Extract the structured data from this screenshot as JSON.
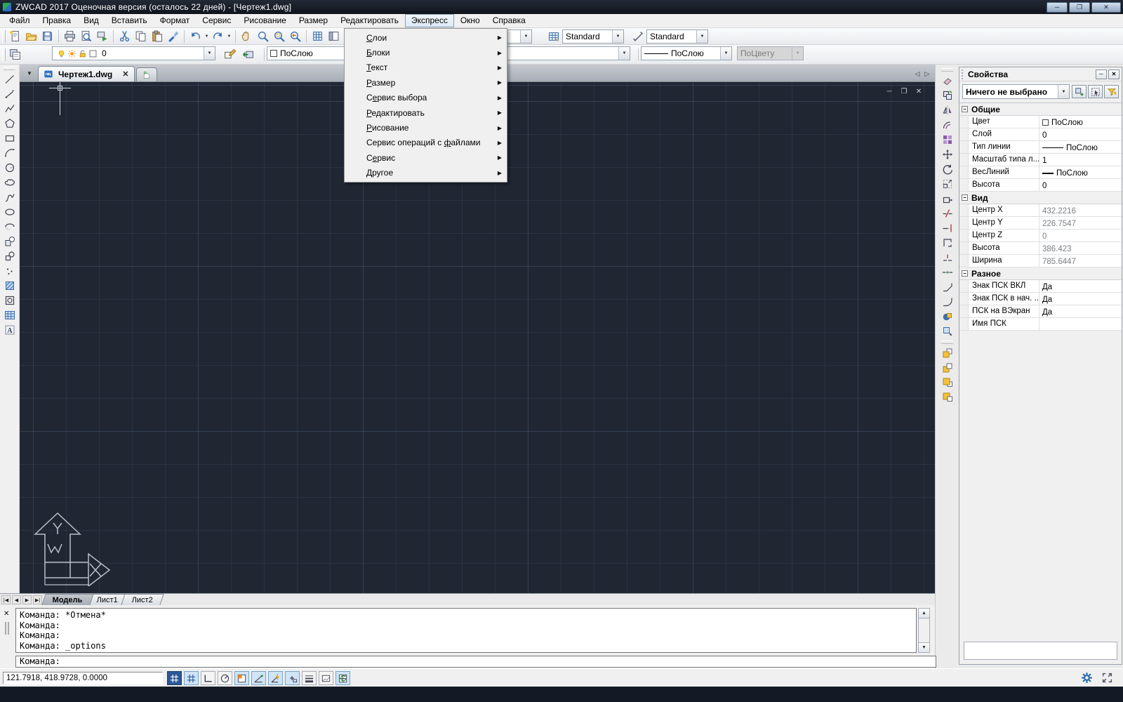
{
  "window": {
    "title": "ZWCAD 2017 Оценочная версия (осталось 22 дней) - [Чертеж1.dwg]",
    "buttons": [
      {
        "name": "minimize",
        "glyph": "─"
      },
      {
        "name": "maximize",
        "glyph": "❐"
      },
      {
        "name": "close",
        "glyph": "✕"
      }
    ]
  },
  "menu_bar": {
    "items": [
      "Файл",
      "Правка",
      "Вид",
      "Вставить",
      "Формат",
      "Сервис",
      "Рисование",
      "Размер",
      "Редактировать",
      "Экспресс",
      "Окно",
      "Справка"
    ],
    "active": "Экспресс"
  },
  "express_menu": {
    "items": [
      {
        "label": "Слои",
        "u": 0
      },
      {
        "label": "Блоки",
        "u": 0
      },
      {
        "label": "Текст",
        "u": 0
      },
      {
        "label": "Размер",
        "u": 0
      },
      {
        "label": "Сервис выбора",
        "u": 1
      },
      {
        "label": "Редактировать",
        "u": 0
      },
      {
        "label": "Рисование",
        "u": 0
      },
      {
        "label": "Сервис операций с файлами",
        "u": 18
      },
      {
        "label": "Сервис",
        "u": 1
      },
      {
        "label": "Другое",
        "u": 0
      }
    ]
  },
  "standard_toolbar": {
    "groups": [
      [
        "new",
        "open",
        "save"
      ],
      [
        "print",
        "print-preview",
        "publish"
      ],
      [
        "cut",
        "copy",
        "paste",
        "match-properties"
      ],
      [
        "undo",
        "redo"
      ],
      [
        "pan",
        "zoom-realtime",
        "zoom-window",
        "zoom-previous"
      ],
      [
        "quick-calc",
        "design-center"
      ],
      [
        "help"
      ]
    ],
    "dropdown_buttons": [
      "undo",
      "redo"
    ]
  },
  "styles_toolbar": {
    "text_style": {
      "value": ""
    },
    "table_style": {
      "value": "Standard"
    },
    "dim_style": {
      "value": "Standard"
    }
  },
  "layers_toolbar": {
    "manager": "layers-manager",
    "layer_combo": {
      "state_icons": [
        "bulb",
        "sun",
        "unlock",
        "swatch"
      ],
      "value": "0"
    },
    "buttons": [
      "layer-current",
      "layer-previous"
    ]
  },
  "properties_toolbar": {
    "color": {
      "value": "ПоСлою"
    },
    "linetype": {
      "value": ""
    },
    "lineweight": {
      "value": "ПоСлою"
    },
    "plot_style": {
      "value": "ПоЦвету",
      "disabled": true
    }
  },
  "doc_tabs": {
    "tabs": [
      {
        "label": "Чертеж1.dwg",
        "active": true
      }
    ]
  },
  "draw_toolbar": [
    "line",
    "ray",
    "polyline",
    "polygon",
    "rectangle",
    "arc",
    "circle",
    "revision-cloud",
    "spline",
    "ellipse",
    "ellipse-arc",
    "insert-block",
    "make-block",
    "point",
    "hatch",
    "region",
    "table",
    "mtext"
  ],
  "modify_toolbar": [
    "erase",
    "copy-object",
    "mirror",
    "offset",
    "array",
    "move",
    "rotate",
    "scale",
    "stretch",
    "trim",
    "extend",
    "break",
    "break-at-point",
    "join",
    "chamfer",
    "fillet",
    "union",
    "explode"
  ],
  "draworder_toolbar": [
    "bring-to-front",
    "send-to-back",
    "bring-above",
    "send-under"
  ],
  "canvas": {
    "mdi_buttons": [
      {
        "name": "minimize",
        "glyph": "─"
      },
      {
        "name": "restore",
        "glyph": "❐"
      },
      {
        "name": "close",
        "glyph": "✕"
      }
    ]
  },
  "ucs": {
    "x_label": "X",
    "y_label": "Y",
    "w_label": "W"
  },
  "properties_panel": {
    "title": "Свойства",
    "minimize_glyph": "─",
    "close_glyph": "✕",
    "selector": "Ничего не выбрано",
    "buttons": [
      "pickadd-toggle",
      "select-objects",
      "quick-select"
    ],
    "sections": [
      {
        "title": "Общие",
        "rows": [
          {
            "label": "Цвет",
            "value": "ПоСлою",
            "swatch": "color"
          },
          {
            "label": "Слой",
            "value": "0"
          },
          {
            "label": "Тип линии",
            "value": "ПоСлою",
            "swatch": "linetype"
          },
          {
            "label": "Масштаб типа л...",
            "value": "1"
          },
          {
            "label": "ВесЛиний",
            "value": "ПоСлою",
            "swatch": "lineweight"
          },
          {
            "label": "Высота",
            "value": "0"
          }
        ]
      },
      {
        "title": "Вид",
        "rows": [
          {
            "label": "Центр X",
            "value": "432.2216",
            "readonly": true
          },
          {
            "label": "Центр Y",
            "value": "226.7547",
            "readonly": true
          },
          {
            "label": "Центр Z",
            "value": "0",
            "readonly": true
          },
          {
            "label": "Высота",
            "value": "386.423",
            "readonly": true
          },
          {
            "label": "Ширина",
            "value": "785.6447",
            "readonly": true
          }
        ]
      },
      {
        "title": "Разное",
        "rows": [
          {
            "label": "Знак ПСК ВКЛ",
            "value": "Да"
          },
          {
            "label": "Знак ПСК в нач. ...",
            "value": "Да"
          },
          {
            "label": "ПСК на ВЭкран",
            "value": "Да"
          },
          {
            "label": "Имя ПСК",
            "value": ""
          }
        ]
      }
    ]
  },
  "layout_tabs": {
    "nav": [
      "first",
      "previous",
      "next",
      "last"
    ],
    "tabs": [
      "Модель",
      "Лист1",
      "Лист2"
    ],
    "active": "Модель"
  },
  "command": {
    "history": [
      "Команда: *Отмена*",
      "Команда:",
      "Команда:",
      "Команда: _options"
    ],
    "prompt": "Команда:"
  },
  "status_bar": {
    "coords": "121.7918, 418.9728, 0.0000",
    "toggles": [
      {
        "name": "snap",
        "state": "dark"
      },
      {
        "name": "grid",
        "state": "on"
      },
      {
        "name": "ortho",
        "state": "off"
      },
      {
        "name": "polar",
        "state": "off"
      },
      {
        "name": "esnap",
        "state": "on"
      },
      {
        "name": "polar-tracking",
        "state": "on"
      },
      {
        "name": "object-tracking",
        "state": "on"
      },
      {
        "name": "dynamic-input",
        "state": "on"
      },
      {
        "name": "lineweight-display",
        "state": "off"
      },
      {
        "name": "model-paper",
        "state": "off"
      },
      {
        "name": "annotation-sync",
        "state": "on"
      }
    ],
    "right_icons": [
      "gear",
      "fullscreen"
    ]
  }
}
